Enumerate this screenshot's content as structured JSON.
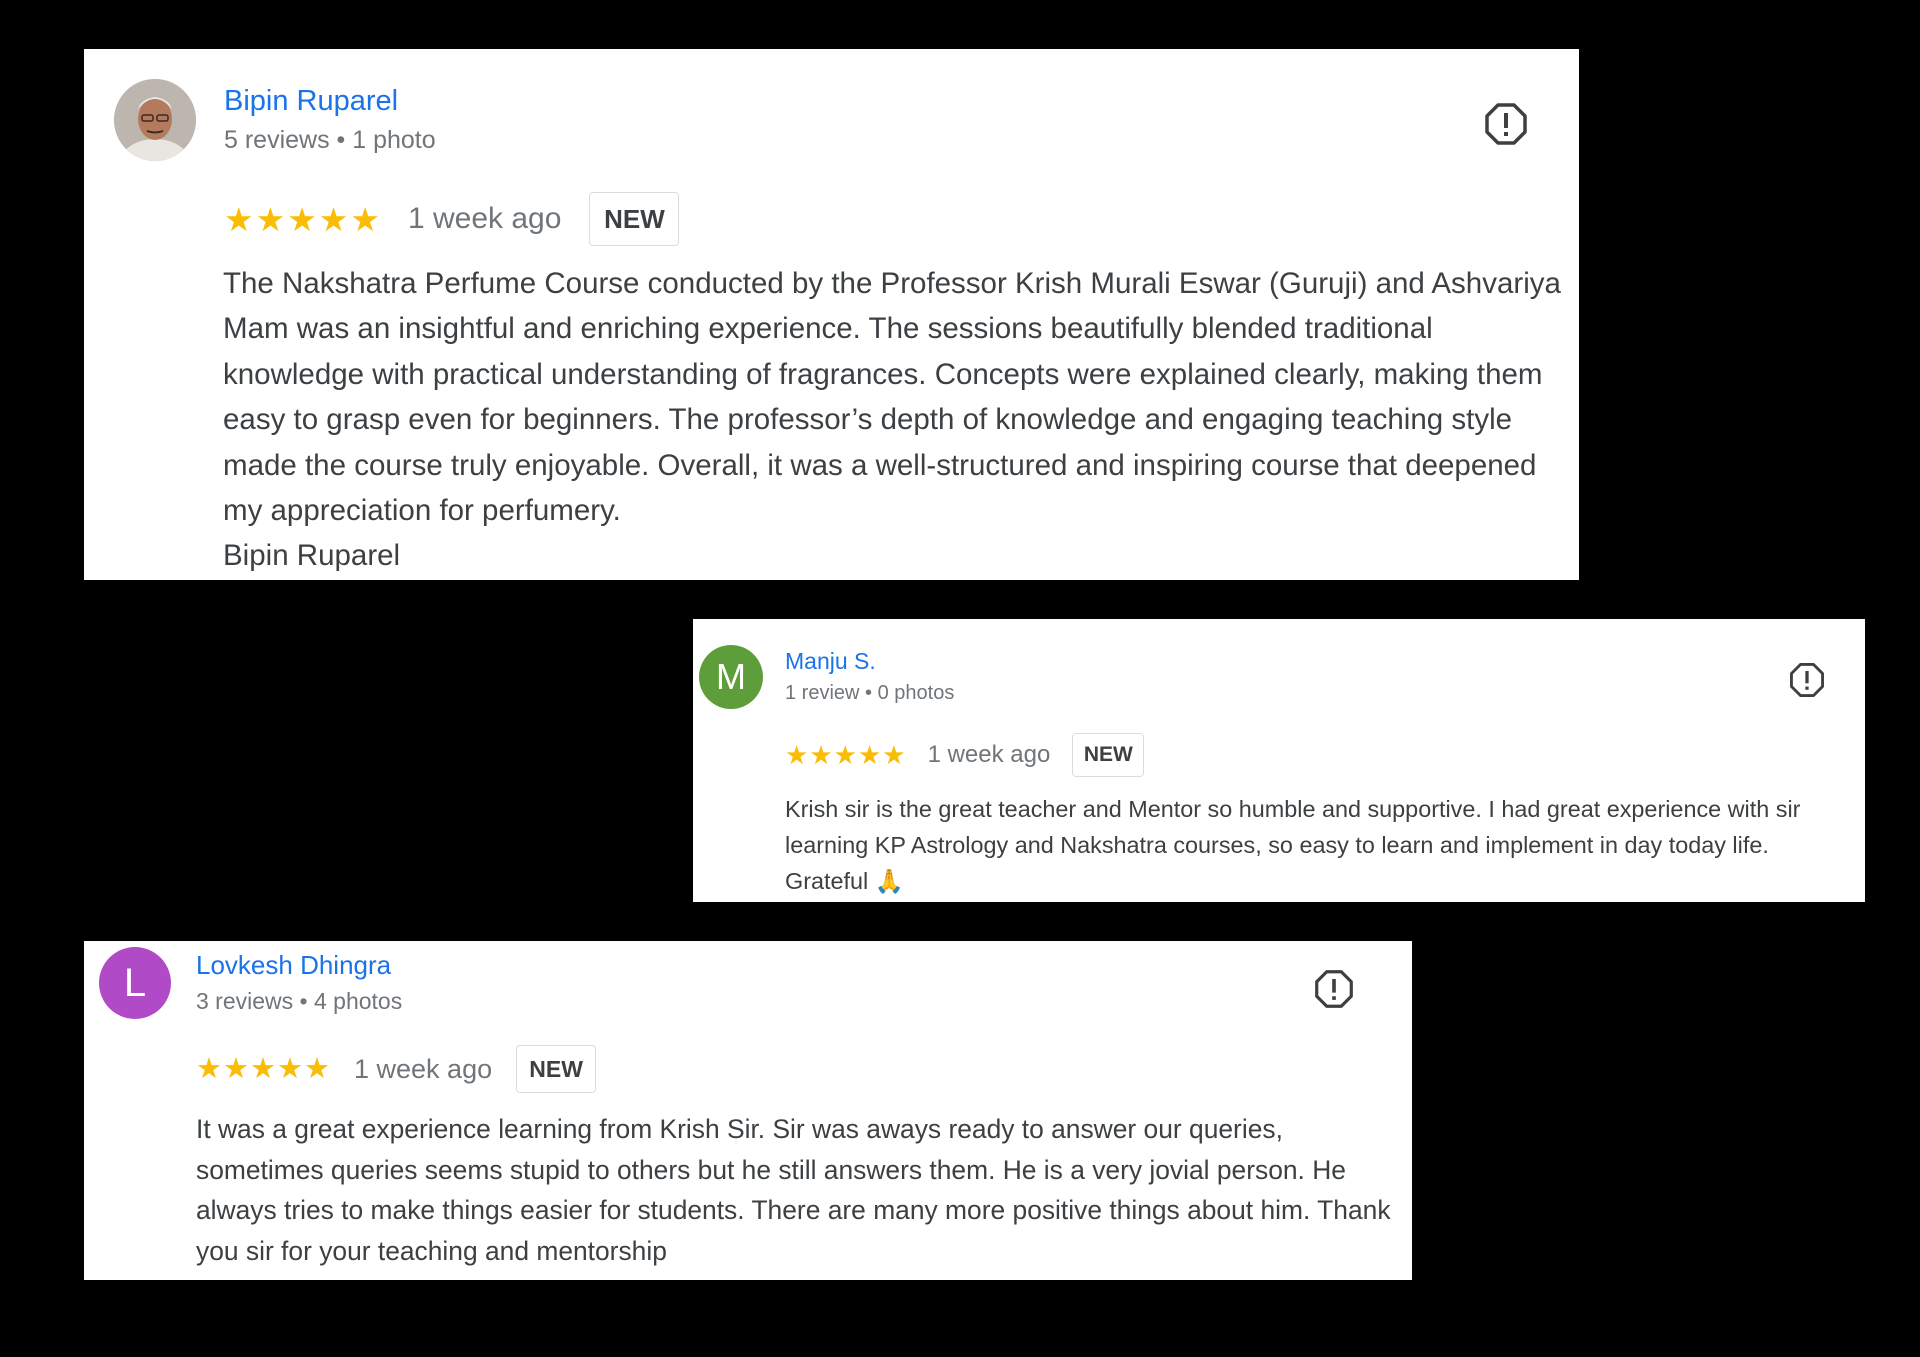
{
  "colors": {
    "name_link": "#1a73e8",
    "star": "#fbbc04",
    "meta": "#70757a",
    "text": "#3c4043",
    "avatar_m": "#5e9e3a",
    "avatar_l": "#b14ac6"
  },
  "reviews": [
    {
      "name": "Bipin Ruparel",
      "meta": "5 reviews • 1 photo",
      "avatar": {
        "type": "photo",
        "icon": "person-photo-avatar"
      },
      "rating": 5,
      "time": "1 week ago",
      "badge": "NEW",
      "text": "The Nakshatra Perfume Course conducted by the Professor Krish Murali Eswar (Guruji) and Ashvariya Mam was an insightful and enriching experience. The sessions beautifully blended traditional knowledge with practical understanding of fragrances. Concepts were explained clearly, making them easy to grasp even for beginners. The professor’s depth of knowledge and engaging teaching style made the course truly enjoyable. Overall, it was a well-structured and inspiring course that deepened my appreciation for perfumery.",
      "signature": "Bipin Ruparel",
      "flag_icon": "report-flag-icon"
    },
    {
      "name": "Manju S.",
      "meta": "1 review • 0 photos",
      "avatar": {
        "type": "letter",
        "letter": "M"
      },
      "rating": 5,
      "time": "1 week ago",
      "badge": "NEW",
      "text": "Krish sir is the great teacher and Mentor so humble and supportive. I had great experience with sir learning KP Astrology and Nakshatra courses, so easy to learn and implement in day today life. Grateful",
      "emoji": "🙏",
      "flag_icon": "report-flag-icon"
    },
    {
      "name": "Lovkesh Dhingra",
      "meta": "3 reviews • 4 photos",
      "avatar": {
        "type": "letter",
        "letter": "L"
      },
      "rating": 5,
      "time": "1 week ago",
      "badge": "NEW",
      "text": "It was a great experience learning from Krish Sir. Sir was aways ready to answer our queries, sometimes queries seems stupid to others but he still answers them. He is a very jovial person. He always tries to make things easier for students. There are many more positive things about him. Thank you sir for your teaching and mentorship",
      "flag_icon": "report-flag-icon"
    }
  ]
}
